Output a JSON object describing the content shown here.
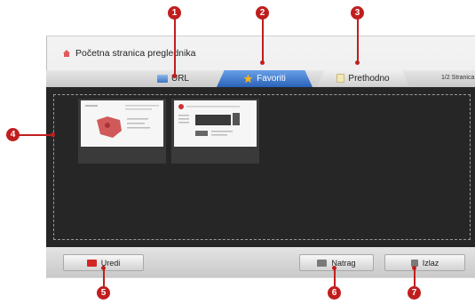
{
  "home": {
    "title": "Početna stranica preglednika"
  },
  "tabs": [
    {
      "label": "URL",
      "icon": "url-icon"
    },
    {
      "label": "Favoriti",
      "icon": "star-icon",
      "active": true
    },
    {
      "label": "Prethodno",
      "icon": "history-icon"
    }
  ],
  "page_indicator": "1/2 Stranica",
  "favorites": [
    {
      "name": "thumbnail-1"
    },
    {
      "name": "thumbnail-2"
    }
  ],
  "buttons": {
    "edit": "Uredi",
    "edit_color": "#d42525",
    "back": "Natrag",
    "exit": "Izlaz"
  },
  "callouts": [
    "1",
    "2",
    "3",
    "4",
    "5",
    "6",
    "7"
  ],
  "colors": {
    "accent": "#2a62b8",
    "callout": "#c01e1e"
  }
}
